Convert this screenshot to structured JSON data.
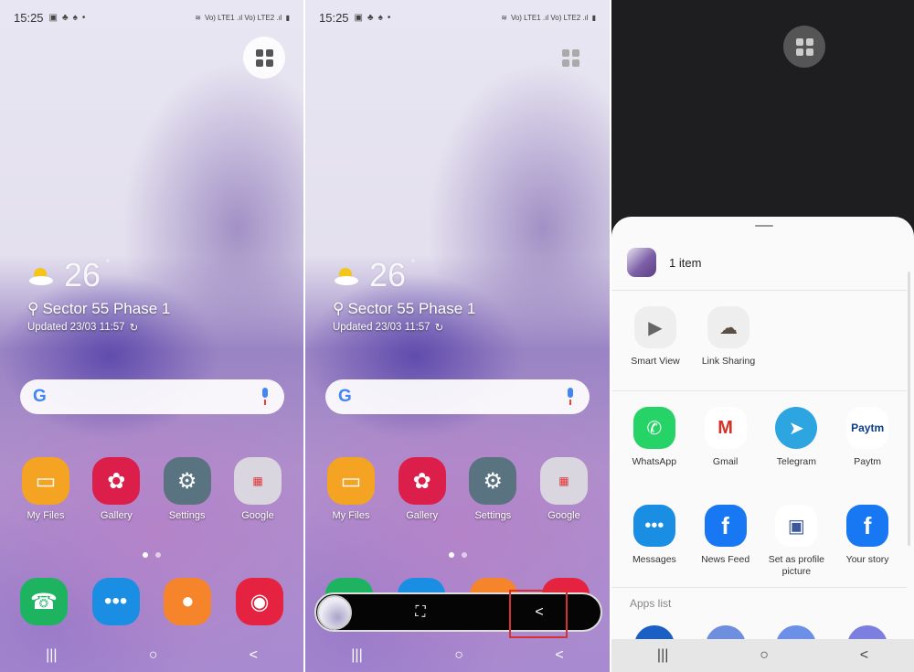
{
  "status_bar": {
    "time": "15:25",
    "network": "Vo) LTE1 .ıl Vo) LTE2 .ıl"
  },
  "home": {
    "weather": {
      "temp": "26",
      "deg": "°",
      "location": "Sector 55 Phase 1",
      "updated": "Updated 23/03 11:57"
    },
    "search": {
      "logo": "G"
    },
    "apps": [
      {
        "label": "My Files",
        "icon": "folder-icon",
        "color": "#f4a322"
      },
      {
        "label": "Gallery",
        "icon": "flower-icon",
        "color": "#dc1e4b"
      },
      {
        "label": "Settings",
        "icon": "gear-icon",
        "color": "#5a7380"
      },
      {
        "label": "Google",
        "icon": "folder-group-icon",
        "color": "#d9d6df"
      }
    ],
    "dock": [
      {
        "icon": "phone-icon",
        "color": "#1db360"
      },
      {
        "icon": "messages-icon",
        "color": "#1a8ee3"
      },
      {
        "icon": "contacts-icon",
        "color": "#f5842a"
      },
      {
        "icon": "camera-icon",
        "color": "#e5223f"
      }
    ]
  },
  "screenshot_toolbar": {
    "crop_icon": "⛶",
    "share_icon": "<"
  },
  "share_sheet": {
    "item_count": "1 item",
    "quick": [
      {
        "label": "Smart View",
        "icon": "smart-view-icon"
      },
      {
        "label": "Link Sharing",
        "icon": "link-sharing-icon"
      }
    ],
    "row1": [
      {
        "label": "WhatsApp",
        "icon": "whatsapp-icon",
        "color": "#25d366"
      },
      {
        "label": "Gmail",
        "icon": "gmail-icon",
        "color": "#ffffff"
      },
      {
        "label": "Telegram",
        "icon": "telegram-icon",
        "color": "#2ca5e0"
      },
      {
        "label": "Paytm",
        "icon": "paytm-icon",
        "color": "#ffffff"
      }
    ],
    "row2": [
      {
        "label": "Messages",
        "icon": "messages-icon",
        "color": "#1a8ee3"
      },
      {
        "label": "News Feed",
        "icon": "facebook-icon",
        "color": "#1877f2"
      },
      {
        "label": "Set as profile picture",
        "icon": "profile-picture-icon",
        "color": "#ffffff"
      },
      {
        "label": "Your story",
        "icon": "facebook-icon",
        "color": "#1877f2"
      }
    ],
    "apps_list_label": "Apps list"
  },
  "nav": {
    "recents": "|||",
    "home": "○",
    "back": "<"
  }
}
